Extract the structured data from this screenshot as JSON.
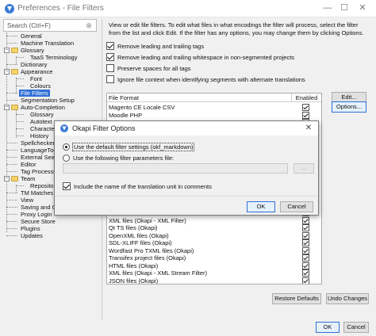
{
  "window": {
    "title": "Preferences - File Filters",
    "minimize_glyph": "—",
    "maximize_glyph": "☐",
    "close_glyph": "✕"
  },
  "search": {
    "placeholder": "Search (Ctrl+F)",
    "clear_glyph": "⊗"
  },
  "tree": [
    {
      "label": "General"
    },
    {
      "label": "Machine Translation"
    },
    {
      "label": "Glossary"
    },
    {
      "label": "TaaS Terminology"
    },
    {
      "label": "Dictionary"
    },
    {
      "label": "Appearance"
    },
    {
      "label": "Font"
    },
    {
      "label": "Colours"
    },
    {
      "label": "File Filters",
      "selected": true
    },
    {
      "label": "Segmentation Setup"
    },
    {
      "label": "Auto-Completion"
    },
    {
      "label": "Glossary"
    },
    {
      "label": "Autotext"
    },
    {
      "label": "Character"
    },
    {
      "label": "History"
    },
    {
      "label": "Spellchecker"
    },
    {
      "label": "LanguageTool"
    },
    {
      "label": "External Sea"
    },
    {
      "label": "Editor"
    },
    {
      "label": "Tag Processin"
    },
    {
      "label": "Team"
    },
    {
      "label": "Repository"
    },
    {
      "label": "TM Matches"
    },
    {
      "label": "View"
    },
    {
      "label": "Saving and O"
    },
    {
      "label": "Proxy Login"
    },
    {
      "label": "Secure Store"
    },
    {
      "label": "Plugins"
    },
    {
      "label": "Updates"
    }
  ],
  "description": "View or edit file filters. To edit what files in what encodings the filter will process, select the filter from the list and click Edit. If the filter has any options, you may change them by clicking Options.",
  "options": [
    {
      "label": "Remove leading and trailing tags",
      "checked": true
    },
    {
      "label": "Remove leading and trailing whitespace in non-segmented projects",
      "checked": true
    },
    {
      "label": "Preserve spaces for all tags",
      "checked": false
    },
    {
      "label": "Ignore file context when identifying segments with alternate translations",
      "checked": false
    }
  ],
  "table": {
    "headers": {
      "name": "File Format",
      "enabled": "Enabled"
    },
    "rows": [
      {
        "name": "Magento CE Locale CSV",
        "enabled": true
      },
      {
        "name": "Moodle PHP",
        "enabled": true
      },
      {
        "name": "",
        "enabled": true
      },
      {
        "name": "",
        "enabled": true
      },
      {
        "name": "",
        "enabled": true
      },
      {
        "name": "",
        "enabled": true
      },
      {
        "name": "",
        "enabled": true
      },
      {
        "name": "",
        "enabled": true
      },
      {
        "name": "",
        "enabled": true
      },
      {
        "name": "",
        "enabled": true
      },
      {
        "name": "",
        "enabled": true
      },
      {
        "name": "",
        "enabled": true
      },
      {
        "name": "",
        "enabled": true
      },
      {
        "name": "",
        "enabled": true
      },
      {
        "name": "",
        "enabled": true
      },
      {
        "name": "XML files (Okapi - XML Filter)",
        "enabled": true
      },
      {
        "name": "Qt TS files (Okapi)",
        "enabled": true
      },
      {
        "name": "OpenXML files (Okapi)",
        "enabled": true
      },
      {
        "name": "SDL-XLIFF files (Okapi)",
        "enabled": true
      },
      {
        "name": "Wordfast Pro TXML files (Okapi)",
        "enabled": true
      },
      {
        "name": "Transifex project files (Okapi)",
        "enabled": true
      },
      {
        "name": "HTML files (Okapi)",
        "enabled": true
      },
      {
        "name": "XML files (Okapi - XML Stream Filter)",
        "enabled": true
      },
      {
        "name": "JSON files (Okapi)",
        "enabled": true
      }
    ]
  },
  "side_buttons": {
    "edit": "Edit...",
    "options": "Options..."
  },
  "footer_buttons": {
    "restore": "Restore Defaults",
    "undo": "Undo Changes"
  },
  "bottom_buttons": {
    "ok": "OK",
    "cancel": "Cancel"
  },
  "dialog": {
    "title": "Okapi Filter Options",
    "close_glyph": "✕",
    "radio_default": {
      "label": "Use the default filter settings (okf_markdown)",
      "selected": true
    },
    "radio_file": {
      "label": "Use the following filter parameters file:",
      "selected": false
    },
    "path_value": "",
    "browse_label": "...",
    "include_name": {
      "label": "Include the name of the translation unit in comments",
      "checked": true
    },
    "ok": "OK",
    "cancel": "Cancel"
  }
}
